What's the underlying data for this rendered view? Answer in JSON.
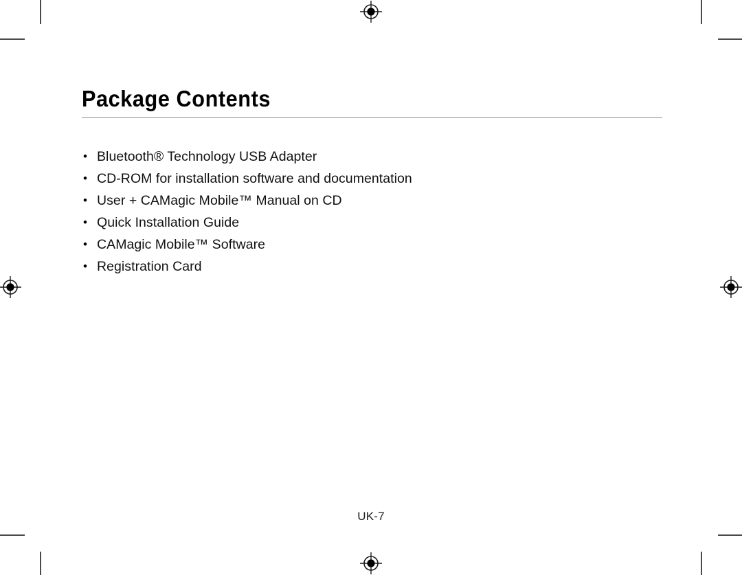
{
  "document": {
    "title": "Package Contents",
    "page_number": "UK-7"
  },
  "contents": {
    "bullet_glyph": "•",
    "items": [
      {
        "text": "Bluetooth® Technology USB Adapter"
      },
      {
        "text": "CD-ROM for installation software and documentation"
      },
      {
        "text": "User + CAMagic Mobile™ Manual on CD"
      },
      {
        "text": "Quick Installation Guide"
      },
      {
        "text": "CAMagic Mobile™ Software"
      },
      {
        "text": "Registration Card"
      }
    ]
  },
  "print_marks": {
    "registration_targets": [
      {
        "name": "registration-mark-top"
      },
      {
        "name": "registration-mark-bottom"
      },
      {
        "name": "registration-mark-left"
      },
      {
        "name": "registration-mark-right"
      }
    ],
    "crop_marks": [
      {
        "name": "crop-mark-top-left"
      },
      {
        "name": "crop-mark-top-right"
      },
      {
        "name": "crop-mark-bottom-left"
      },
      {
        "name": "crop-mark-bottom-right"
      }
    ]
  },
  "colors": {
    "page_background": "#ffffff",
    "text": "#111111",
    "rule": "#8a8a8a",
    "crop_mark": "#4a4a4a"
  }
}
